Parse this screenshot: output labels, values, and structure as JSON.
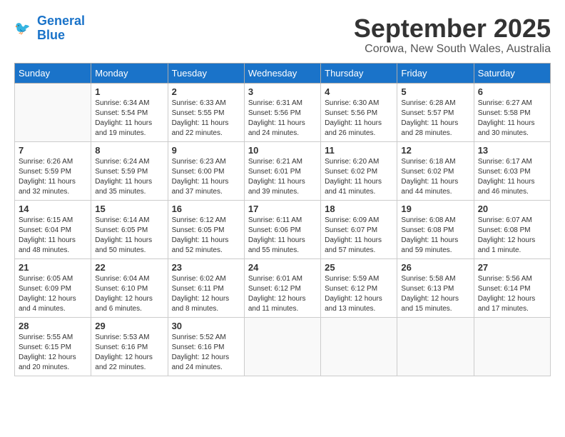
{
  "header": {
    "logo_line1": "General",
    "logo_line2": "Blue",
    "month": "September 2025",
    "location": "Corowa, New South Wales, Australia"
  },
  "weekdays": [
    "Sunday",
    "Monday",
    "Tuesday",
    "Wednesday",
    "Thursday",
    "Friday",
    "Saturday"
  ],
  "weeks": [
    [
      {
        "day": "",
        "info": ""
      },
      {
        "day": "1",
        "info": "Sunrise: 6:34 AM\nSunset: 5:54 PM\nDaylight: 11 hours\nand 19 minutes."
      },
      {
        "day": "2",
        "info": "Sunrise: 6:33 AM\nSunset: 5:55 PM\nDaylight: 11 hours\nand 22 minutes."
      },
      {
        "day": "3",
        "info": "Sunrise: 6:31 AM\nSunset: 5:56 PM\nDaylight: 11 hours\nand 24 minutes."
      },
      {
        "day": "4",
        "info": "Sunrise: 6:30 AM\nSunset: 5:56 PM\nDaylight: 11 hours\nand 26 minutes."
      },
      {
        "day": "5",
        "info": "Sunrise: 6:28 AM\nSunset: 5:57 PM\nDaylight: 11 hours\nand 28 minutes."
      },
      {
        "day": "6",
        "info": "Sunrise: 6:27 AM\nSunset: 5:58 PM\nDaylight: 11 hours\nand 30 minutes."
      }
    ],
    [
      {
        "day": "7",
        "info": "Sunrise: 6:26 AM\nSunset: 5:59 PM\nDaylight: 11 hours\nand 32 minutes."
      },
      {
        "day": "8",
        "info": "Sunrise: 6:24 AM\nSunset: 5:59 PM\nDaylight: 11 hours\nand 35 minutes."
      },
      {
        "day": "9",
        "info": "Sunrise: 6:23 AM\nSunset: 6:00 PM\nDaylight: 11 hours\nand 37 minutes."
      },
      {
        "day": "10",
        "info": "Sunrise: 6:21 AM\nSunset: 6:01 PM\nDaylight: 11 hours\nand 39 minutes."
      },
      {
        "day": "11",
        "info": "Sunrise: 6:20 AM\nSunset: 6:02 PM\nDaylight: 11 hours\nand 41 minutes."
      },
      {
        "day": "12",
        "info": "Sunrise: 6:18 AM\nSunset: 6:02 PM\nDaylight: 11 hours\nand 44 minutes."
      },
      {
        "day": "13",
        "info": "Sunrise: 6:17 AM\nSunset: 6:03 PM\nDaylight: 11 hours\nand 46 minutes."
      }
    ],
    [
      {
        "day": "14",
        "info": "Sunrise: 6:15 AM\nSunset: 6:04 PM\nDaylight: 11 hours\nand 48 minutes."
      },
      {
        "day": "15",
        "info": "Sunrise: 6:14 AM\nSunset: 6:05 PM\nDaylight: 11 hours\nand 50 minutes."
      },
      {
        "day": "16",
        "info": "Sunrise: 6:12 AM\nSunset: 6:05 PM\nDaylight: 11 hours\nand 52 minutes."
      },
      {
        "day": "17",
        "info": "Sunrise: 6:11 AM\nSunset: 6:06 PM\nDaylight: 11 hours\nand 55 minutes."
      },
      {
        "day": "18",
        "info": "Sunrise: 6:09 AM\nSunset: 6:07 PM\nDaylight: 11 hours\nand 57 minutes."
      },
      {
        "day": "19",
        "info": "Sunrise: 6:08 AM\nSunset: 6:08 PM\nDaylight: 11 hours\nand 59 minutes."
      },
      {
        "day": "20",
        "info": "Sunrise: 6:07 AM\nSunset: 6:08 PM\nDaylight: 12 hours\nand 1 minute."
      }
    ],
    [
      {
        "day": "21",
        "info": "Sunrise: 6:05 AM\nSunset: 6:09 PM\nDaylight: 12 hours\nand 4 minutes."
      },
      {
        "day": "22",
        "info": "Sunrise: 6:04 AM\nSunset: 6:10 PM\nDaylight: 12 hours\nand 6 minutes."
      },
      {
        "day": "23",
        "info": "Sunrise: 6:02 AM\nSunset: 6:11 PM\nDaylight: 12 hours\nand 8 minutes."
      },
      {
        "day": "24",
        "info": "Sunrise: 6:01 AM\nSunset: 6:12 PM\nDaylight: 12 hours\nand 11 minutes."
      },
      {
        "day": "25",
        "info": "Sunrise: 5:59 AM\nSunset: 6:12 PM\nDaylight: 12 hours\nand 13 minutes."
      },
      {
        "day": "26",
        "info": "Sunrise: 5:58 AM\nSunset: 6:13 PM\nDaylight: 12 hours\nand 15 minutes."
      },
      {
        "day": "27",
        "info": "Sunrise: 5:56 AM\nSunset: 6:14 PM\nDaylight: 12 hours\nand 17 minutes."
      }
    ],
    [
      {
        "day": "28",
        "info": "Sunrise: 5:55 AM\nSunset: 6:15 PM\nDaylight: 12 hours\nand 20 minutes."
      },
      {
        "day": "29",
        "info": "Sunrise: 5:53 AM\nSunset: 6:16 PM\nDaylight: 12 hours\nand 22 minutes."
      },
      {
        "day": "30",
        "info": "Sunrise: 5:52 AM\nSunset: 6:16 PM\nDaylight: 12 hours\nand 24 minutes."
      },
      {
        "day": "",
        "info": ""
      },
      {
        "day": "",
        "info": ""
      },
      {
        "day": "",
        "info": ""
      },
      {
        "day": "",
        "info": ""
      }
    ]
  ]
}
